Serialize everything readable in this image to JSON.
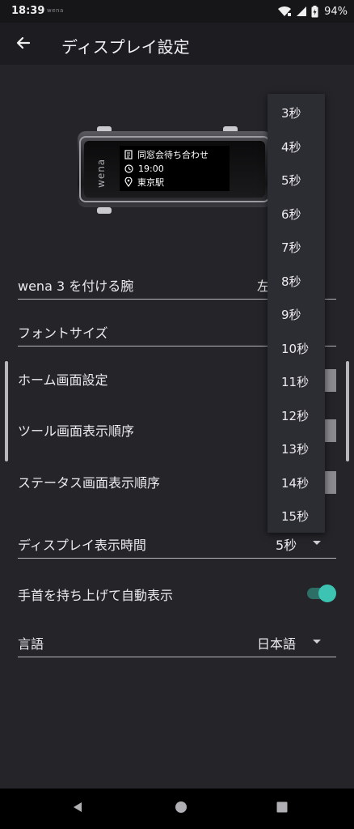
{
  "status_bar": {
    "time": "18:39",
    "app_label": "wena",
    "battery_percent": "94%",
    "icons": [
      "wifi-icon",
      "signal-icon",
      "battery-icon"
    ]
  },
  "app_bar": {
    "back_icon": "arrow-left-icon",
    "title": "ディスプレイ設定"
  },
  "device_preview": {
    "brand": "wena",
    "screen_lines": [
      {
        "icon": "calendar-icon",
        "text": "同窓会待ち合わせ"
      },
      {
        "icon": "clock-icon",
        "text": "19:00"
      },
      {
        "icon": "location-icon",
        "text": "東京駅"
      }
    ]
  },
  "settings": {
    "wrist": {
      "label": "wena 3 を付ける腕",
      "value": "左"
    },
    "font_size": {
      "label": "フォントサイズ"
    },
    "home_screen": {
      "label": "ホーム画面設定"
    },
    "tool_order": {
      "label": "ツール画面表示順序"
    },
    "status_order": {
      "label": "ステータス画面表示順序"
    },
    "display_time": {
      "label": "ディスプレイ表示時間",
      "value": "5秒"
    },
    "raise_to_wake": {
      "label": "手首を持ち上げて自動表示",
      "enabled": true
    },
    "language": {
      "label": "言語",
      "value": "日本語"
    }
  },
  "dropdown_options": [
    "3秒",
    "4秒",
    "5秒",
    "6秒",
    "7秒",
    "8秒",
    "9秒",
    "10秒",
    "11秒",
    "12秒",
    "13秒",
    "14秒",
    "15秒"
  ],
  "nav_bar": {
    "icons": [
      "back-triangle-icon",
      "home-circle-icon",
      "recents-square-icon"
    ]
  },
  "colors": {
    "background": "#242429",
    "accent": "#3cc3b2",
    "app_bar": "#1d1d21",
    "dropdown": "#2c2c33"
  }
}
